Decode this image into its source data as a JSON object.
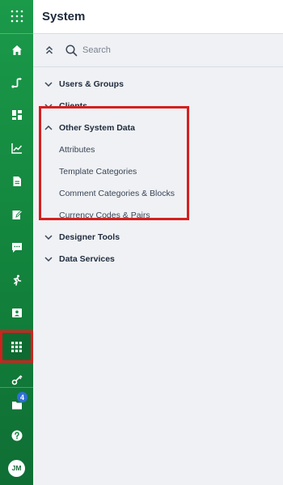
{
  "header": {
    "title": "System"
  },
  "toolbar": {
    "search_placeholder": "Search"
  },
  "tree": {
    "users_groups": "Users & Groups",
    "clients": "Clients",
    "other_system_data": {
      "label": "Other System Data",
      "children": [
        "Attributes",
        "Template Categories",
        "Comment Categories & Blocks",
        "Currency Codes & Pairs"
      ]
    },
    "designer_tools": "Designer Tools",
    "data_services": "Data Services"
  },
  "rail": {
    "notifications_count": "4",
    "user_initials": "JM",
    "active_item": "apps"
  },
  "colors": {
    "rail_green": "#1b9a4a",
    "highlight_red": "#d51f1f",
    "badge_blue": "#2f6fd6"
  }
}
